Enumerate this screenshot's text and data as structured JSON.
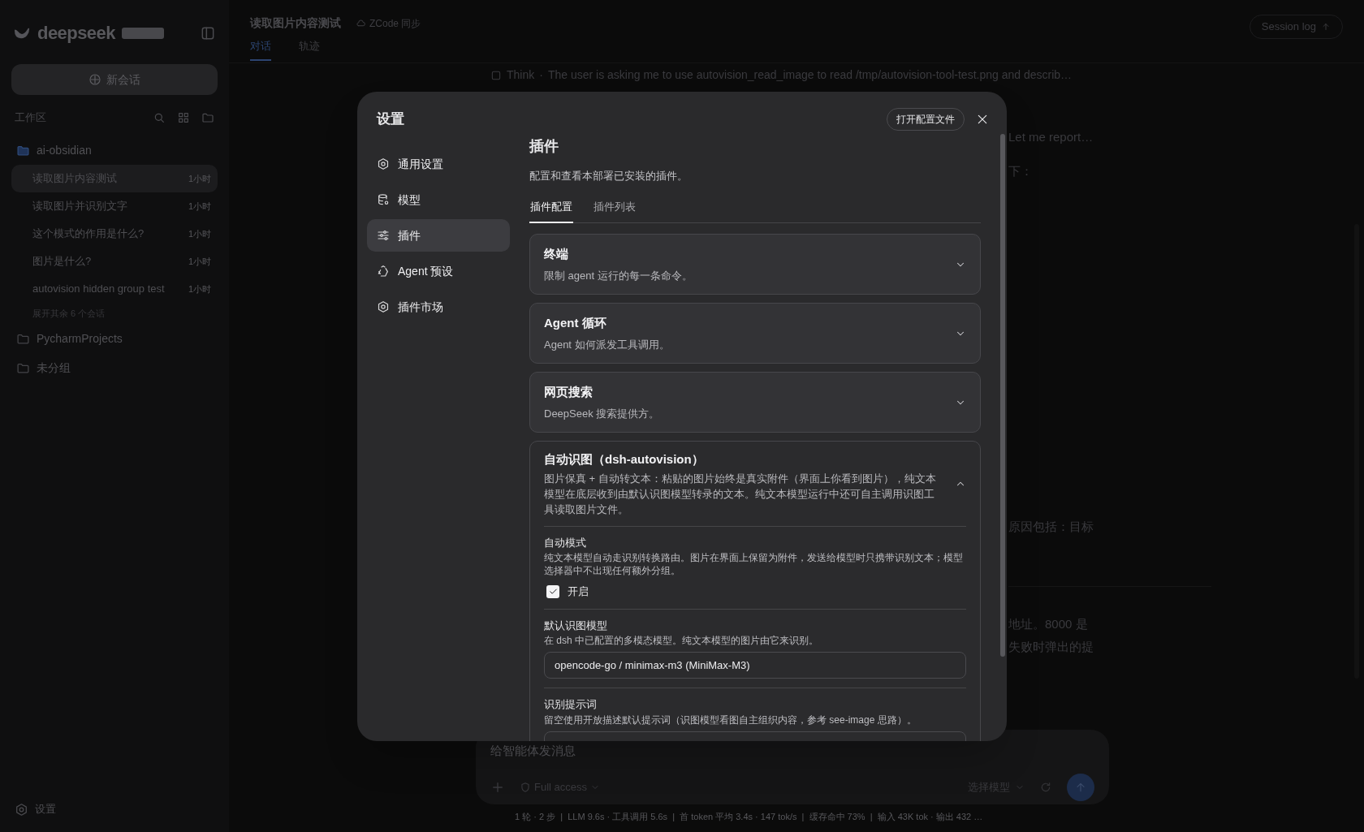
{
  "sidebar": {
    "logo": "deepseek",
    "new_chat": "新会话",
    "section": "工作区",
    "folders": [
      {
        "name": "ai-obsidian",
        "expanded": true,
        "sessions": [
          {
            "title": "读取图片内容测试",
            "time": "1小时",
            "selected": true
          },
          {
            "title": "读取图片并识别文字",
            "time": "1小时",
            "selected": false
          },
          {
            "title": "这个模式的作用是什么?",
            "time": "1小时",
            "selected": false
          },
          {
            "title": "图片是什么?",
            "time": "1小时",
            "selected": false
          },
          {
            "title": "autovision hidden group test",
            "time": "1小时",
            "selected": false
          }
        ],
        "more": "展开其余 6 个会话"
      },
      {
        "name": "PycharmProjects",
        "expanded": false
      },
      {
        "name": "未分组",
        "expanded": false
      }
    ],
    "settings": "设置"
  },
  "conversation": {
    "title": "读取图片内容测试",
    "sync": "ZCode 同步",
    "tabs": [
      {
        "label": "对话",
        "selected": true
      },
      {
        "label": "轨迹",
        "selected": false
      }
    ],
    "session_log": "Session log",
    "think": {
      "label": "Think",
      "separator": "·",
      "text": "The user is asking me to use autovision_read_image to read /tmp/autovision-tool-test.png and describ…"
    },
    "fragments": [
      "Let me report…",
      "下：",
      "原因包括：目标",
      "地址。8000 是",
      "失败时弹出的提"
    ]
  },
  "composer": {
    "placeholder": "给智能体发消息",
    "access": "Full access",
    "model": "选择模型"
  },
  "stats": "1 轮 · 2 步  |  LLM 9.6s · 工具调用 5.6s  |  首 token 平均 3.4s · 147 tok/s  |  缓存命中 73%  |  输入 43K tok · 输出 432 …",
  "settings_dialog": {
    "title": "设置",
    "open_config": "打开配置文件",
    "nav": [
      {
        "label": "通用设置",
        "selected": false
      },
      {
        "label": "模型",
        "selected": false
      },
      {
        "label": "插件",
        "selected": true
      },
      {
        "label": "Agent 预设",
        "selected": false
      },
      {
        "label": "插件市场",
        "selected": false
      }
    ],
    "heading": "插件",
    "description": "配置和查看本部署已安装的插件。",
    "tabs": [
      {
        "label": "插件配置",
        "selected": true
      },
      {
        "label": "插件列表",
        "selected": false
      }
    ],
    "plugins": [
      {
        "name": "终端",
        "description": "限制 agent 运行的每一条命令。",
        "expanded": false
      },
      {
        "name": "Agent 循环",
        "description": "Agent 如何派发工具调用。",
        "expanded": false
      },
      {
        "name": "网页搜索",
        "description": "DeepSeek 搜索提供方。",
        "expanded": false
      },
      {
        "name": "自动识图（dsh-autovision）",
        "description": "图片保真 + 自动转文本：粘贴的图片始终是真实附件（界面上你看到图片），纯文本模型在底层收到由默认识图模型转录的文本。纯文本模型运行中还可自主调用识图工具读取图片文件。",
        "expanded": true,
        "settings": [
          {
            "kind": "checkbox",
            "label": "自动模式",
            "help": "纯文本模型自动走识别转换路由。图片在界面上保留为附件，发送给模型时只携带识别文本；模型选择器中不出现任何额外分组。",
            "option": "开启",
            "checked": true
          },
          {
            "kind": "text",
            "label": "默认识图模型",
            "help": "在 dsh 中已配置的多模态模型。纯文本模型的图片由它来识别。",
            "value": "opencode-go / minimax-m3 (MiniMax-M3)"
          },
          {
            "kind": "textarea",
            "label": "识别提示词",
            "help": "留空使用开放描述默认提示词（识图模型看图自主组织内容，参考 see-image 思路）。"
          }
        ]
      }
    ]
  }
}
